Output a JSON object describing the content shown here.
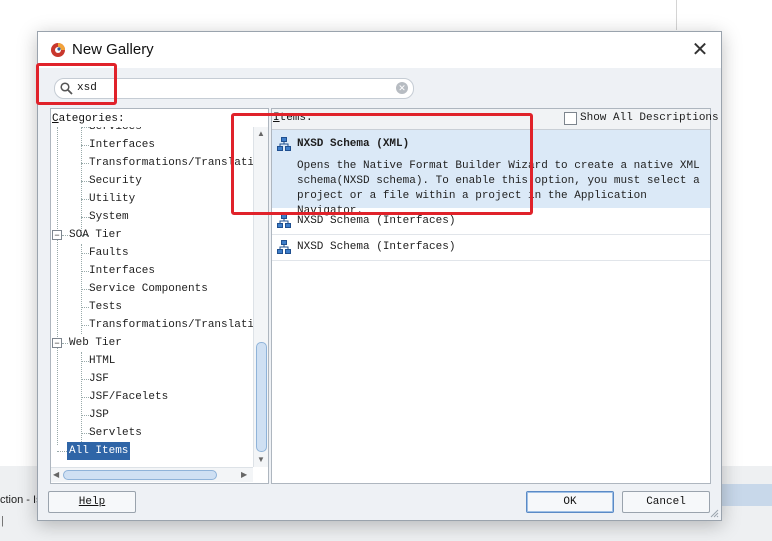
{
  "dialog": {
    "title": "New Gallery"
  },
  "search": {
    "value": "xsd",
    "clear_icon": "clear-icon"
  },
  "categories": {
    "label_prefix": "C",
    "label_rest": "ategories:",
    "tree": [
      {
        "label": "Services"
      },
      {
        "label": "Interfaces"
      },
      {
        "label": "Transformations/Translatio"
      },
      {
        "label": "Security"
      },
      {
        "label": "Utility"
      },
      {
        "label": "System"
      },
      {
        "label": "SOA Tier",
        "toggle": "⊟"
      },
      {
        "label": "Faults"
      },
      {
        "label": "Interfaces"
      },
      {
        "label": "Service Components"
      },
      {
        "label": "Tests"
      },
      {
        "label": "Transformations/Translatio"
      },
      {
        "label": "Web Tier",
        "toggle": "⊟"
      },
      {
        "label": "HTML"
      },
      {
        "label": "JSF"
      },
      {
        "label": "JSF/Facelets"
      },
      {
        "label": "JSP"
      },
      {
        "label": "Servlets"
      },
      {
        "label": "All Items"
      }
    ]
  },
  "items": {
    "label_prefix": "I",
    "label_rest": "tems:",
    "show_all_label": "Show All Descriptions",
    "list": [
      {
        "title": "NXSD Schema (XML)",
        "description": "Opens the Native Format Builder Wizard to create a native XML schema(NXSD schema). To enable this option, you must select a project or a file within a project in the Application Navigator."
      },
      {
        "title": "NXSD Schema (Interfaces)"
      },
      {
        "title": "NXSD Schema (Interfaces)"
      }
    ]
  },
  "buttons": {
    "help": "Help",
    "ok": "OK",
    "cancel": "Cancel"
  },
  "background": {
    "status_text": "ction - Is",
    "cursor_mark": "|"
  },
  "colors": {
    "selection": "#2f65a7",
    "item_highlight": "#dbe9f7",
    "annotation": "#e0222a"
  }
}
